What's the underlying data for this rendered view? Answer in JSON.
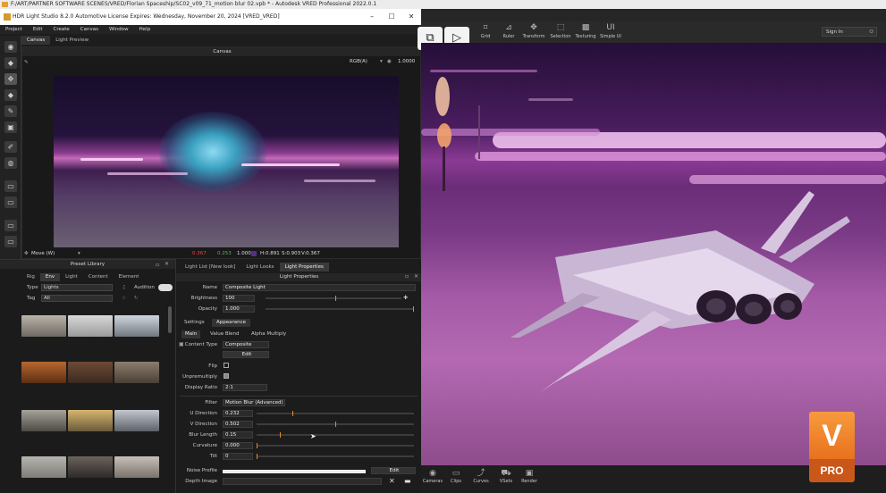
{
  "outer_title": "F:/ART/PARTNER SOFTWARE SCENES/VRED/Florian Spaceship/SC02_v09_71_motion blur 02.vpb * - Autodesk VRED Professional 2022.0.1",
  "hdr_window": {
    "title": "HDR Light Studio 8.2.0  Automotive License Expires: Wednesday, November 20, 2024  [VRED_VRED]",
    "menu": [
      "Project",
      "Edit",
      "Create",
      "Canvas",
      "Window",
      "Help"
    ],
    "tabs": [
      "Canvas",
      "Light Preview"
    ],
    "canvas": {
      "header": "Canvas",
      "color_mode": "RGB(A)",
      "exposure": "1.0000",
      "mode": "Move (W)",
      "pixel_readout": {
        "r": "0.367",
        "g": "0.253",
        "b": "1.000",
        "h": "H:0.891",
        "s": "S:0.903",
        "v": "V:0.367"
      }
    },
    "preset_library": {
      "header": "Preset Library",
      "tabs": [
        "Rig",
        "Env",
        "Light",
        "Content",
        "Element"
      ],
      "type_label": "Type",
      "type_value": "Lights",
      "tag_label": "Tag",
      "tag_value": "All",
      "audition_label": "Audition"
    },
    "light_panel": {
      "tabs": [
        "Light List [New look]",
        "Light Looks",
        "Light Properties"
      ],
      "header": "Light Properties",
      "name_label": "Name",
      "name_value": "Composite Light",
      "brightness_label": "Brightness",
      "brightness_value": "100",
      "opacity_label": "Opacity",
      "opacity_value": "1.000",
      "subtabs": [
        "Settings",
        "Appearance"
      ],
      "subtabs2": [
        "Main",
        "Value Blend",
        "Alpha Multiply"
      ],
      "content_type_label": "Content Type",
      "content_type_value": "Composite",
      "edit_label": "Edit",
      "flip_label": "Flip",
      "unpremultiply_label": "Unpremultiply",
      "display_ratio_label": "Display Ratio",
      "display_ratio_value": "2:1",
      "filter_label": "Filter",
      "filter_value": "Motion Blur (Advanced)",
      "u_dir_label": "U Direction",
      "u_dir_value": "0.232",
      "v_dir_label": "V Direction",
      "v_dir_value": "0.502",
      "blur_len_label": "Blur Length",
      "blur_len_value": "0.15",
      "curvature_label": "Curvature",
      "curvature_value": "0.000",
      "tilt_label": "Tilt",
      "tilt_value": "0",
      "noise_label": "Noise Profile",
      "noise_edit": "Edit",
      "depth_label": "Depth Image"
    }
  },
  "vred": {
    "toolbar": [
      "Grid",
      "Ruler",
      "Transform",
      "Selection",
      "Texturing",
      "Simple UI"
    ],
    "sign_in": "Sign In",
    "bottom": [
      "Cameras",
      "Clips",
      "Curves",
      "VSets",
      "Render"
    ],
    "badge_letter": "V",
    "badge_text": "PRO"
  },
  "colors": {
    "accent": "#e08a2e",
    "badge_top": "#f28a36",
    "badge_bottom": "#c9571a"
  }
}
